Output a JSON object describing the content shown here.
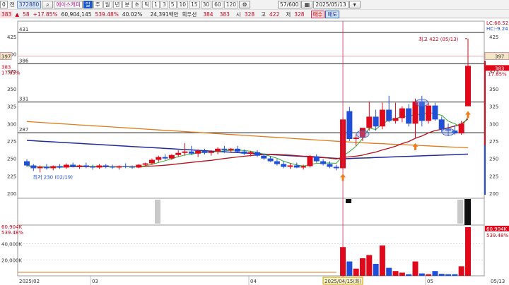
{
  "toolbar": {
    "row1": {
      "left_value": "0",
      "jeon_label": "전",
      "code": "372880",
      "name": "에이스캐피",
      "period_buttons": [
        "일",
        "주",
        "월",
        "년",
        "분",
        "초",
        "틱"
      ],
      "minute_buttons": [
        "1",
        "3",
        "5",
        "10",
        "15",
        "30",
        "60",
        "120"
      ],
      "page_counter": "57/600",
      "date": "2025/05/13"
    },
    "row2": {
      "current_price": "383",
      "change": "58",
      "change_pct": "+17.85%",
      "volume": "60,904,145",
      "volume_ratio": "539.48%",
      "turnover_rate": "40.02%",
      "turnover_value": "24,391백만",
      "unit_label": "회우선",
      "bid1": "384",
      "bid2": "383",
      "open_label": "시",
      "open_value": "328",
      "high_label": "고",
      "high_value": "422",
      "low_label": "저",
      "low_value": "328",
      "buy_label": "매수",
      "sell_label": "매도"
    }
  },
  "chart": {
    "price_axis_ticks": [
      "425",
      "400",
      "375",
      "350",
      "325",
      "300",
      "275",
      "250",
      "225",
      "200"
    ],
    "volume_axis_ticks": [
      "40,000K",
      "20,000K"
    ],
    "hlines": [
      {
        "label": "431",
        "value": 431
      },
      {
        "label": "386",
        "value": 386
      },
      {
        "label": "331",
        "value": 331
      },
      {
        "label": "287",
        "value": 287
      }
    ],
    "axis_left_current": "397",
    "axis_right_current": "397",
    "left_price_tag": "383",
    "left_pct_tag": "17.85%",
    "right_price_tag": "383",
    "right_pct_tag": "17.85%",
    "right_info_1": "LC:66.52",
    "right_info_2": "HC:-9.24",
    "volume_tag_left": "60.904K",
    "volume_pct_left": "539.48%",
    "volume_tag_right": "60.904K",
    "volume_pct_right": "539.48%",
    "high_annotation": "최고 422 (05/13)",
    "low_annotation": "최저 230 (02/19)",
    "crosshair_date": "2025/04/15(화)",
    "date_labels": [
      "2025/02",
      "03",
      "04",
      "05",
      "05/13"
    ],
    "colors": {
      "up": "#e0091b",
      "down": "#1f4fd6",
      "ma5": "#2faa2f",
      "ma20": "#b5121b",
      "ma60": "#e07b1a",
      "ma120": "#232b9a",
      "arrow": "#f07c1a"
    }
  },
  "chart_data": {
    "type": "candlestick",
    "candles": [
      {
        "o": 246,
        "h": 249,
        "l": 238,
        "c": 240
      },
      {
        "o": 240,
        "h": 242,
        "l": 232,
        "c": 236
      },
      {
        "o": 236,
        "h": 240,
        "l": 230,
        "c": 238
      },
      {
        "o": 238,
        "h": 242,
        "l": 234,
        "c": 236
      },
      {
        "o": 236,
        "h": 240,
        "l": 233,
        "c": 239
      },
      {
        "o": 239,
        "h": 242,
        "l": 235,
        "c": 237
      },
      {
        "o": 237,
        "h": 243,
        "l": 235,
        "c": 241
      },
      {
        "o": 241,
        "h": 244,
        "l": 237,
        "c": 238
      },
      {
        "o": 238,
        "h": 241,
        "l": 235,
        "c": 240
      },
      {
        "o": 240,
        "h": 244,
        "l": 236,
        "c": 238
      },
      {
        "o": 238,
        "h": 241,
        "l": 234,
        "c": 237
      },
      {
        "o": 237,
        "h": 242,
        "l": 235,
        "c": 240
      },
      {
        "o": 240,
        "h": 242,
        "l": 236,
        "c": 238
      },
      {
        "o": 238,
        "h": 241,
        "l": 235,
        "c": 237
      },
      {
        "o": 237,
        "h": 240,
        "l": 234,
        "c": 239
      },
      {
        "o": 239,
        "h": 243,
        "l": 236,
        "c": 238
      },
      {
        "o": 238,
        "h": 240,
        "l": 235,
        "c": 237
      },
      {
        "o": 237,
        "h": 242,
        "l": 236,
        "c": 241
      },
      {
        "o": 241,
        "h": 244,
        "l": 238,
        "c": 243
      },
      {
        "o": 243,
        "h": 250,
        "l": 241,
        "c": 248
      },
      {
        "o": 248,
        "h": 254,
        "l": 245,
        "c": 252
      },
      {
        "o": 252,
        "h": 256,
        "l": 248,
        "c": 250
      },
      {
        "o": 250,
        "h": 256,
        "l": 248,
        "c": 255
      },
      {
        "o": 255,
        "h": 262,
        "l": 252,
        "c": 258
      },
      {
        "o": 258,
        "h": 272,
        "l": 254,
        "c": 260
      },
      {
        "o": 260,
        "h": 268,
        "l": 255,
        "c": 257
      },
      {
        "o": 257,
        "h": 263,
        "l": 252,
        "c": 261
      },
      {
        "o": 261,
        "h": 264,
        "l": 256,
        "c": 258
      },
      {
        "o": 258,
        "h": 262,
        "l": 254,
        "c": 260
      },
      {
        "o": 260,
        "h": 266,
        "l": 256,
        "c": 264
      },
      {
        "o": 264,
        "h": 268,
        "l": 258,
        "c": 262
      },
      {
        "o": 262,
        "h": 265,
        "l": 258,
        "c": 264
      },
      {
        "o": 264,
        "h": 268,
        "l": 259,
        "c": 260
      },
      {
        "o": 260,
        "h": 263,
        "l": 255,
        "c": 257
      },
      {
        "o": 257,
        "h": 261,
        "l": 253,
        "c": 259
      },
      {
        "o": 259,
        "h": 262,
        "l": 252,
        "c": 254
      },
      {
        "o": 254,
        "h": 257,
        "l": 248,
        "c": 250
      },
      {
        "o": 250,
        "h": 253,
        "l": 245,
        "c": 246
      },
      {
        "o": 246,
        "h": 249,
        "l": 240,
        "c": 242
      },
      {
        "o": 242,
        "h": 246,
        "l": 236,
        "c": 238
      },
      {
        "o": 238,
        "h": 243,
        "l": 235,
        "c": 240
      },
      {
        "o": 240,
        "h": 244,
        "l": 236,
        "c": 237
      },
      {
        "o": 237,
        "h": 241,
        "l": 234,
        "c": 239
      },
      {
        "o": 239,
        "h": 255,
        "l": 237,
        "c": 253
      },
      {
        "o": 253,
        "h": 256,
        "l": 244,
        "c": 246
      },
      {
        "o": 246,
        "h": 249,
        "l": 240,
        "c": 242
      },
      {
        "o": 242,
        "h": 246,
        "l": 236,
        "c": 238
      },
      {
        "o": 238,
        "h": 241,
        "l": 233,
        "c": 236
      },
      {
        "o": 236,
        "h": 309,
        "l": 234,
        "c": 306
      },
      {
        "o": 318,
        "h": 324,
        "l": 275,
        "c": 278
      },
      {
        "o": 278,
        "h": 285,
        "l": 268,
        "c": 280
      },
      {
        "o": 280,
        "h": 290,
        "l": 275,
        "c": 294
      },
      {
        "o": 294,
        "h": 332,
        "l": 290,
        "c": 310
      },
      {
        "o": 310,
        "h": 320,
        "l": 290,
        "c": 296
      },
      {
        "o": 296,
        "h": 330,
        "l": 292,
        "c": 320
      },
      {
        "o": 320,
        "h": 340,
        "l": 302,
        "c": 304
      },
      {
        "o": 304,
        "h": 330,
        "l": 300,
        "c": 308
      },
      {
        "o": 308,
        "h": 325,
        "l": 302,
        "c": 322
      },
      {
        "o": 322,
        "h": 328,
        "l": 296,
        "c": 300
      },
      {
        "o": 300,
        "h": 336,
        "l": 280,
        "c": 332
      },
      {
        "o": 332,
        "h": 340,
        "l": 296,
        "c": 304
      },
      {
        "o": 304,
        "h": 330,
        "l": 300,
        "c": 326
      },
      {
        "o": 326,
        "h": 330,
        "l": 304,
        "c": 306
      },
      {
        "o": 306,
        "h": 310,
        "l": 288,
        "c": 292
      },
      {
        "o": 292,
        "h": 300,
        "l": 282,
        "c": 290
      },
      {
        "o": 290,
        "h": 298,
        "l": 284,
        "c": 286
      },
      {
        "o": 286,
        "h": 304,
        "l": 284,
        "c": 300
      },
      {
        "o": 325,
        "h": 422,
        "l": 328,
        "c": 383
      }
    ],
    "volume_k": [
      0,
      0,
      0,
      0,
      0,
      0,
      0,
      0,
      0,
      0,
      0,
      0,
      0,
      0,
      0,
      0,
      0,
      0,
      0,
      0,
      0,
      0,
      0,
      0,
      0,
      0,
      0,
      0,
      0,
      0,
      0,
      0,
      0,
      0,
      0,
      0,
      0,
      0,
      0,
      0,
      0,
      0,
      0,
      0,
      0,
      0,
      0,
      0,
      36000,
      18000,
      9000,
      22000,
      26000,
      15000,
      38000,
      10000,
      6000,
      4000,
      2000,
      18000,
      3000,
      2000,
      6000,
      2500,
      2000,
      2000,
      12000,
      60904
    ],
    "moving_averages": [
      "ma5",
      "ma20",
      "ma60",
      "ma120"
    ],
    "ylim": [
      200,
      435
    ],
    "volume_ylim": [
      0,
      60904
    ]
  }
}
